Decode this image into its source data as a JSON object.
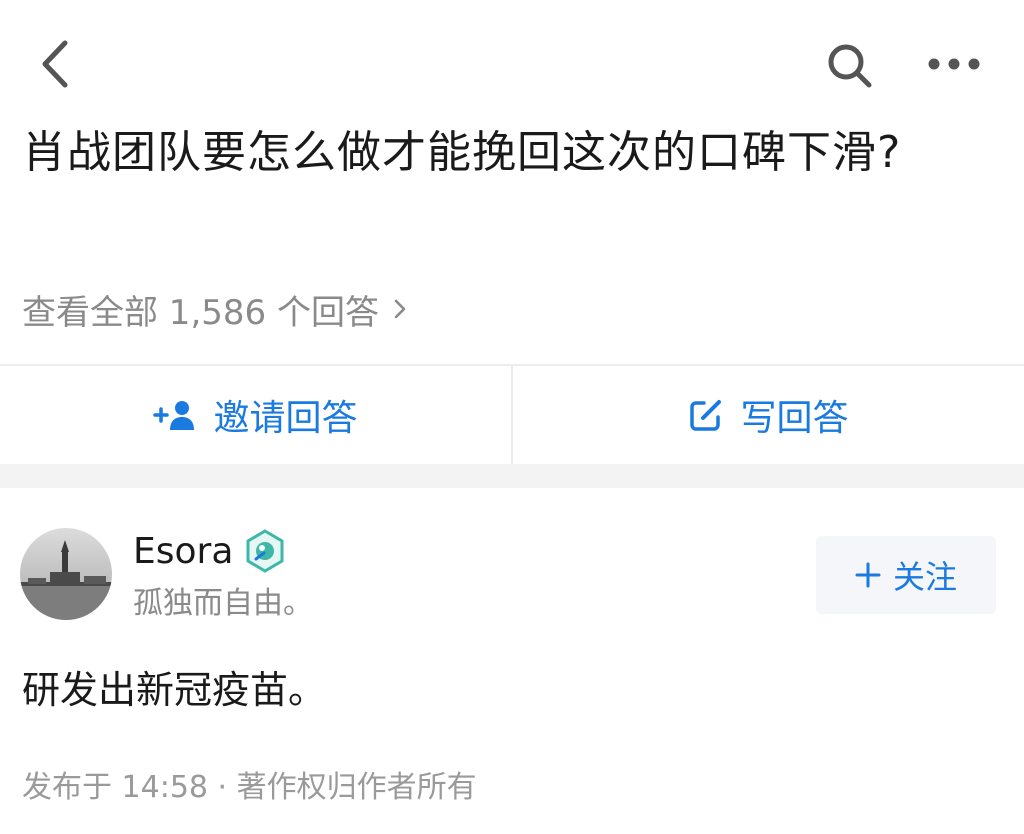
{
  "nav": {
    "back_icon": "chevron-left-icon",
    "search_icon": "search-icon",
    "more_icon": "more-dots-icon"
  },
  "question": {
    "title": "肖战团队要怎么做才能挽回这次的口碑下滑?",
    "view_all_label": "查看全部 1,586 个回答"
  },
  "actions": {
    "invite_label": "邀请回答",
    "invite_icon": "add-person-icon",
    "write_label": "写回答",
    "write_icon": "edit-icon"
  },
  "answer": {
    "author_name": "Esora",
    "author_bio": "孤独而自由。",
    "follow_label": "关注",
    "body": "研发出新冠疫苗。",
    "meta": "发布于 14:58 · 著作权归作者所有"
  },
  "colors": {
    "accent": "#1a7ae0",
    "text_primary": "#1a1a1a",
    "text_secondary": "#8a8a8a",
    "divider": "#ececec"
  }
}
